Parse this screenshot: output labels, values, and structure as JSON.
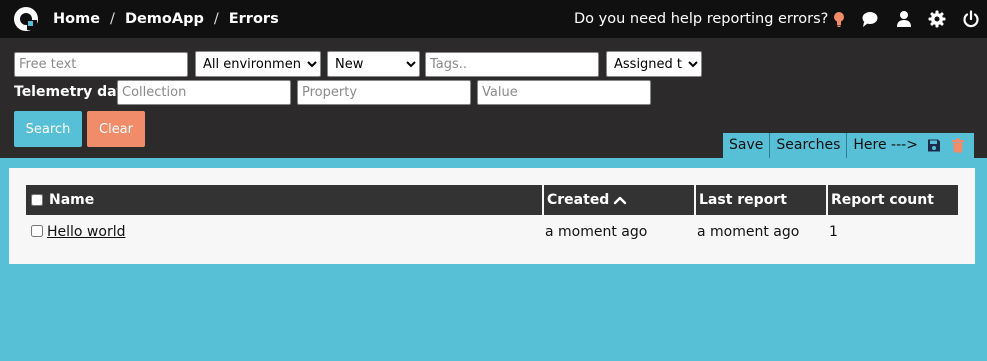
{
  "breadcrumb": [
    "Home",
    "DemoApp",
    "Errors"
  ],
  "header": {
    "help_text": "Do you need help reporting errors?"
  },
  "filters": {
    "free_text_placeholder": "Free text",
    "environment_selected": "All environments",
    "status_selected": "New",
    "tags_placeholder": "Tags..",
    "assigned_selected": "Assigned to",
    "telemetry_label": "Telemetry data",
    "collection_placeholder": "Collection",
    "property_placeholder": "Property",
    "value_placeholder": "Value",
    "search_label": "Search",
    "clear_label": "Clear"
  },
  "saved_searches": {
    "save_label": "Save",
    "searches_label": "Searches",
    "here_label": "Here --->"
  },
  "table": {
    "columns": [
      "Name",
      "Created",
      "Last report",
      "Report count"
    ],
    "sort_indicator": "^",
    "rows": [
      {
        "name": "Hello world",
        "created": "a moment ago",
        "last_report": "a moment ago",
        "report_count": "1"
      }
    ]
  },
  "colors": {
    "background": "#57bfd6",
    "topbar": "#101010",
    "panel": "#2c2a2a",
    "search_button": "#57bfd6",
    "clear_button": "#f08c6a",
    "bulb_icon": "#f08c6a",
    "trash_icon": "#f08c6a"
  },
  "icons": [
    "logo-icon",
    "lightbulb-icon",
    "chat-icon",
    "user-icon",
    "gear-icon",
    "power-icon",
    "save-icon",
    "trash-icon",
    "sort-up-icon"
  ]
}
